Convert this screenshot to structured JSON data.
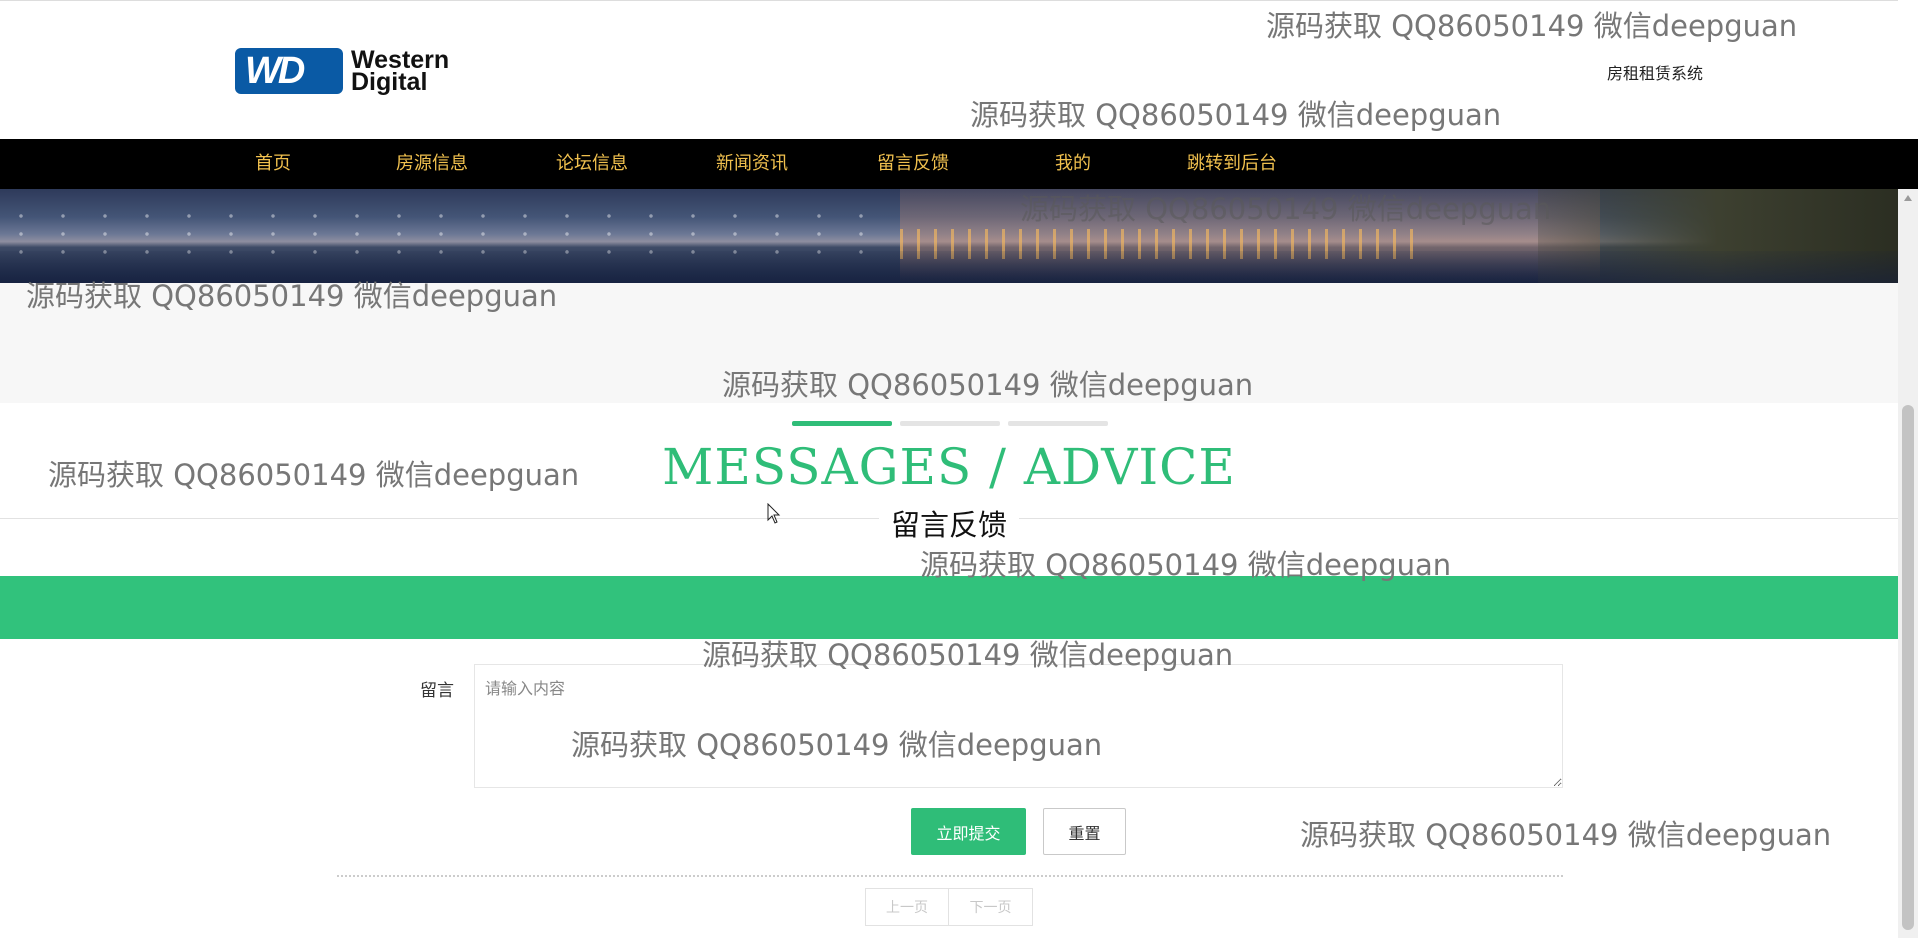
{
  "header": {
    "logo_line1": "Western",
    "logo_line2": "Digital",
    "logo_mark": "WD",
    "system_name": "房租租赁系统"
  },
  "nav": {
    "items": [
      {
        "label": "首页"
      },
      {
        "label": "房源信息"
      },
      {
        "label": "论坛信息"
      },
      {
        "label": "新闻资讯"
      },
      {
        "label": "留言反馈"
      },
      {
        "label": "我的"
      },
      {
        "label": "跳转到后台"
      }
    ]
  },
  "section": {
    "title_en": "MESSAGES / ADVICE",
    "title_cn": "留言反馈"
  },
  "form": {
    "message_label": "留言",
    "message_placeholder": "请输入内容",
    "message_value": "",
    "submit_label": "立即提交",
    "reset_label": "重置"
  },
  "pagination": {
    "prev_label": "上一页",
    "next_label": "下一页"
  },
  "watermark": {
    "text": "源码获取 QQ86050149 微信deepguan"
  },
  "colors": {
    "accent_green": "#2fbd78",
    "nav_bg": "#000000",
    "nav_text": "#f0c04e"
  },
  "icons": {
    "cursor": "mouse-pointer-icon",
    "scroll_up": "chevron-up-icon"
  }
}
